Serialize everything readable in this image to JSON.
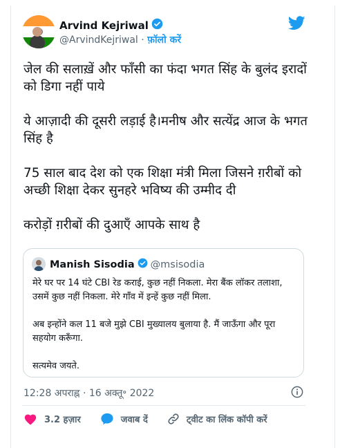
{
  "author": {
    "name": "Arvind Kejriwal",
    "handle": "@ArvindKejriwal",
    "separator": "·",
    "follow_label": "फ़ॉलो करें"
  },
  "tweet": {
    "paragraphs": [
      "जेल की सलाख़ें और फाँसी का फंदा भगत सिंह के बुलंद इरादों को डिगा नहीं पाये",
      "ये आज़ादी की दूसरी लड़ाई है।मनीष और सत्येंद्र आज के भगत सिंह है",
      "75 साल बाद देश को एक शिक्षा मंत्री मिला जिसने ग़रीबों को अच्छी शिक्षा देकर सुनहरे भविष्य की उम्मीद दी",
      "करोड़ों ग़रीबों की दुआएँ आपके साथ है"
    ]
  },
  "quoted": {
    "name": "Manish Sisodia",
    "handle": "@msisodia",
    "paragraphs": [
      "मेरे घर पर 14 घंटे CBI रेड कराई, कुछ नहीं निकला. मेरा बैंक लॉकर तलाशा, उसमें कुछ नहीं निकला. मेरे गाँव में इन्हें कुछ नहीं मिला.",
      "अब इन्होंने कल 11 बजे मुझे CBI मुख्यालय बुलाया है. मैं जाऊँगा और पूरा सहयोग करूँगा.",
      "सत्यमेव जयते."
    ]
  },
  "timestamp": "12:28 अपराह्न · 16 अक्तू॰ 2022",
  "actions": {
    "like_count": "3.2 हज़ार",
    "reply_label": "जवाब दें",
    "copy_link_label": "ट्वीट का लिंक कॉपी करें"
  },
  "colors": {
    "accent": "#1d9bf0",
    "like": "#f91880",
    "text": "#0f1419",
    "secondary": "#536471",
    "border": "#cfd9de"
  },
  "icons": [
    "verified-badge-icon",
    "twitter-bird-icon",
    "info-icon",
    "heart-icon",
    "reply-bubble-icon",
    "link-icon"
  ]
}
